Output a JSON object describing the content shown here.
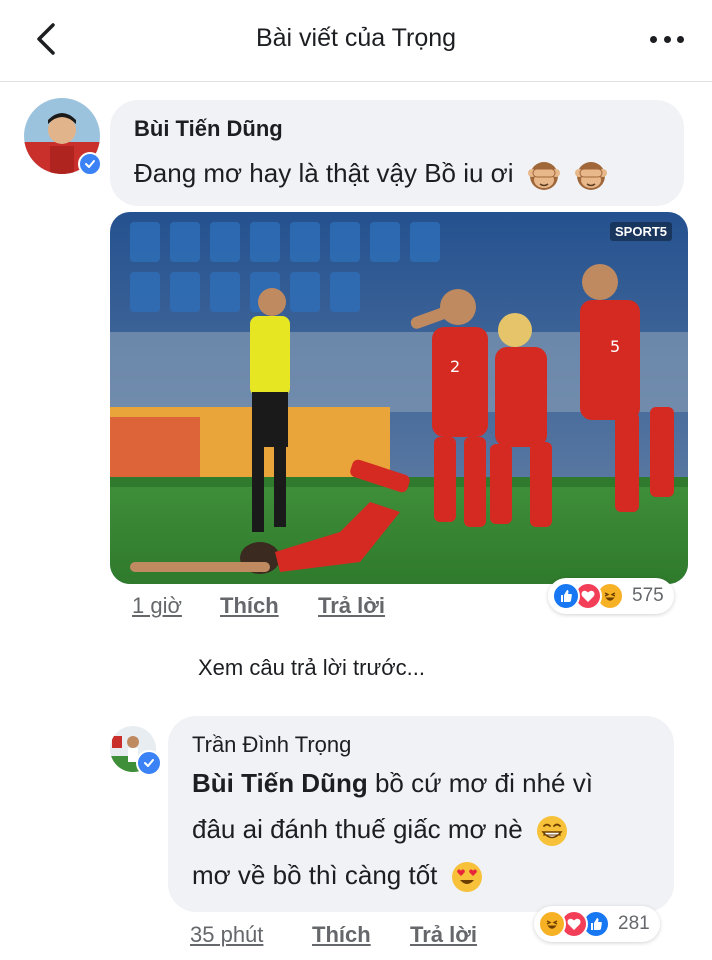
{
  "header": {
    "title": "Bài viết của Trọng"
  },
  "comment1": {
    "author": "Bùi Tiến Dũng",
    "text": "Đang mơ hay là thật vậy Bồ iu ơi",
    "emojis": [
      "see-no-evil-monkey-icon",
      "see-no-evil-monkey-icon"
    ],
    "photo_watermark": "SPORT5",
    "time": "1 giờ",
    "like_label": "Thích",
    "reply_label": "Trả lời",
    "reaction_count": "575",
    "reactions": [
      "like",
      "love",
      "haha"
    ]
  },
  "view_previous": "Xem câu trả lời trước...",
  "comment2": {
    "author": "Trần Đình Trọng",
    "mention": "Bùi Tiến Dũng",
    "line1_rest": " bồ cứ mơ đi nhé vì",
    "line2": "đâu ai đánh thuế giấc mơ nè",
    "line3": "mơ về bồ thì càng tốt",
    "time": "35 phút",
    "like_label": "Thích",
    "reply_label": "Trả lời",
    "reaction_count": "281",
    "reactions": [
      "haha",
      "love",
      "like"
    ]
  },
  "colors": {
    "like_blue": "#1877f2",
    "love_red": "#f33e58",
    "haha_yellow": "#f7b125",
    "bubble_bg": "#f0f2f5"
  }
}
